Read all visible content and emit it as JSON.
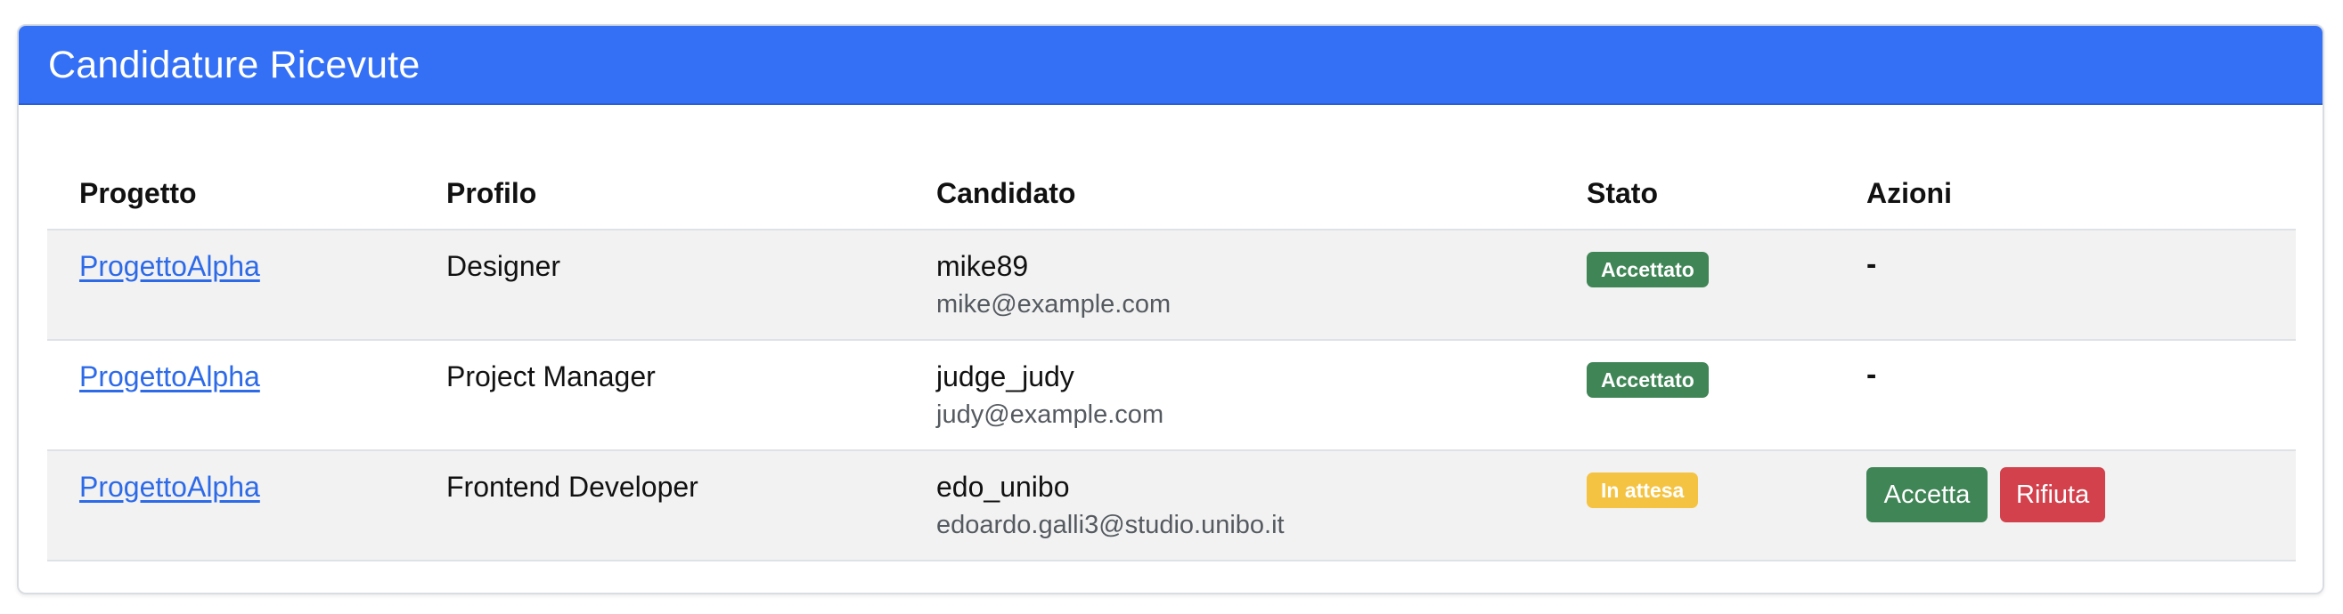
{
  "header": {
    "title": "Candidature Ricevute"
  },
  "table": {
    "columns": [
      "Progetto",
      "Profilo",
      "Candidato",
      "Stato",
      "Azioni"
    ],
    "rows": [
      {
        "project": "ProgettoAlpha",
        "profile": "Designer",
        "candidate_username": "mike89",
        "candidate_email": "mike@example.com",
        "status": "Accettato",
        "status_kind": "accepted",
        "actions": "-"
      },
      {
        "project": "ProgettoAlpha",
        "profile": "Project Manager",
        "candidate_username": "judge_judy",
        "candidate_email": "judy@example.com",
        "status": "Accettato",
        "status_kind": "accepted",
        "actions": "-"
      },
      {
        "project": "ProgettoAlpha",
        "profile": "Frontend Developer",
        "candidate_username": "edo_unibo",
        "candidate_email": "edoardo.galli3@studio.unibo.it",
        "status": "In attesa",
        "status_kind": "pending",
        "accept_label": "Accetta",
        "reject_label": "Rifiuta"
      }
    ]
  },
  "colors": {
    "header_bg": "#3470f6",
    "link": "#2d6ae8",
    "success": "#3f8556",
    "warning": "#f5c342",
    "danger": "#d2414c",
    "stripe": "#f2f2f2"
  }
}
